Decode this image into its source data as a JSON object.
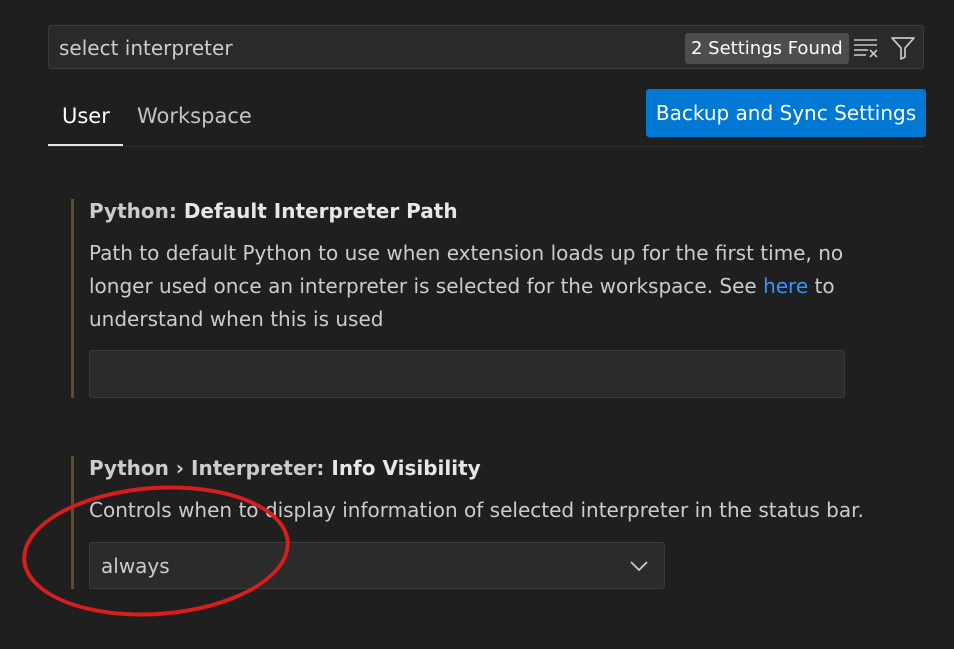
{
  "search": {
    "value": "select interpreter",
    "result_count": "2 Settings Found",
    "clear_icon": "clear-filter-icon",
    "filter_icon": "filter-icon"
  },
  "tabs": [
    {
      "label": "User",
      "active": true
    },
    {
      "label": "Workspace",
      "active": false
    }
  ],
  "sync_button": {
    "label": "Backup and Sync Settings"
  },
  "settings": [
    {
      "category": "Python: ",
      "name": "Default Interpreter Path",
      "description_before": "Path to default Python to use when extension loads up for the first time, no longer used once an interpreter is selected for the workspace. See ",
      "description_link": "here",
      "description_after": " to understand when this is used",
      "value": ""
    },
    {
      "category": "Python › Interpreter: ",
      "name": "Info Visibility",
      "description": "Controls when to display information of selected interpreter in the status bar.",
      "value": "always"
    }
  ],
  "colors": {
    "background": "#1f1f1f",
    "accent_button": "#0078d4",
    "link": "#3794ff",
    "modified_bar": "#5e4e23",
    "annotation": "#d81d1d"
  }
}
